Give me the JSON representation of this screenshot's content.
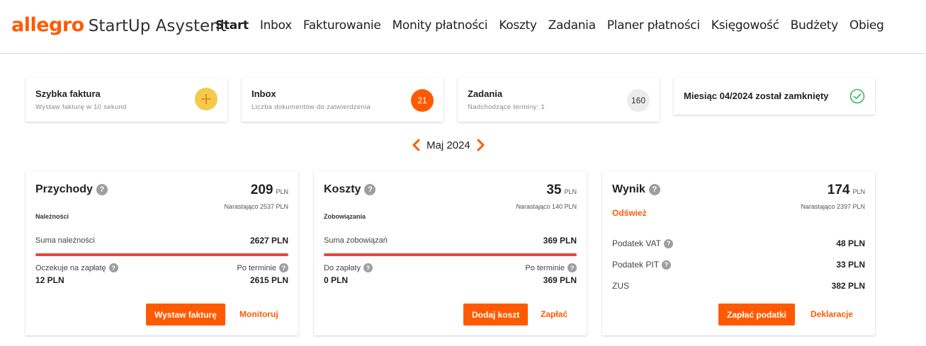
{
  "header": {
    "brand": "allegro",
    "product": "StartUp Asystent",
    "nav": [
      {
        "label": "Start",
        "active": true
      },
      {
        "label": "Inbox"
      },
      {
        "label": "Fakturowanie"
      },
      {
        "label": "Monity płatności"
      },
      {
        "label": "Koszty"
      },
      {
        "label": "Zadania"
      },
      {
        "label": "Planer płatności"
      },
      {
        "label": "Księgowość"
      },
      {
        "label": "Budżety"
      },
      {
        "label": "Obieg"
      }
    ]
  },
  "tiles": {
    "quick_invoice": {
      "title": "Szybka faktura",
      "subtitle": "Wystaw fakturę w 10 sekund",
      "icon": "plus-icon"
    },
    "inbox": {
      "title": "Inbox",
      "subtitle": "Liczba dokumentów do zatwierdzenia",
      "badge": "21"
    },
    "tasks": {
      "title": "Zadania",
      "subtitle": "Nadchodzące terminy: 1",
      "badge": "160"
    },
    "month_closed": {
      "title": "Miesiąc 04/2024 został zamknięty",
      "icon": "check-circle-icon"
    }
  },
  "month_selector": {
    "label": "Maj 2024"
  },
  "income": {
    "title": "Przychody",
    "amount": "209",
    "currency": "PLN",
    "cumulative": "Narastająco 2537 PLN",
    "subhead": "Należności",
    "sum_label": "Suma należności",
    "sum_value": "2627 PLN",
    "waiting_label": "Oczekuje na zapłatę",
    "waiting_value": "12 PLN",
    "overdue_label": "Po terminie",
    "overdue_value": "2615 PLN",
    "primary_button": "Wystaw fakturę",
    "link_button": "Monitoruj"
  },
  "costs": {
    "title": "Koszty",
    "amount": "35",
    "currency": "PLN",
    "cumulative": "Narastająco 140 PLN",
    "subhead": "Zobowiązania",
    "sum_label": "Suma zobowiązań",
    "sum_value": "369 PLN",
    "waiting_label": "Do zapłaty",
    "waiting_value": "0 PLN",
    "overdue_label": "Po terminie",
    "overdue_value": "369 PLN",
    "primary_button": "Dodaj koszt",
    "link_button": "Zapłać"
  },
  "result": {
    "title": "Wynik",
    "amount": "174",
    "currency": "PLN",
    "cumulative": "Narastająco 2397 PLN",
    "refresh": "Odśwież",
    "vat_label": "Podatek VAT",
    "vat_value": "48 PLN",
    "pit_label": "Podatek PIT",
    "pit_value": "33 PLN",
    "zus_label": "ZUS",
    "zus_value": "382 PLN",
    "primary_button": "Zapłać podatki",
    "link_button": "Deklaracje"
  },
  "colors": {
    "accent": "#ff5a00",
    "bar": "#e8453c",
    "plus_bg": "#f6c94b",
    "check": "#3cb95c"
  }
}
